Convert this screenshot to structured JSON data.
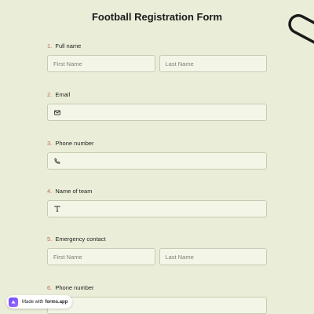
{
  "form": {
    "title": "Football Registration Form"
  },
  "questions": [
    {
      "number": "1.",
      "label": "Full name",
      "fields": [
        {
          "placeholder": "First Name"
        },
        {
          "placeholder": "Last Name"
        }
      ]
    },
    {
      "number": "2.",
      "label": "Email",
      "icon": "envelope-icon"
    },
    {
      "number": "3.",
      "label": "Phone number",
      "icon": "phone-icon"
    },
    {
      "number": "4.",
      "label": "Name of team",
      "icon": "text-icon"
    },
    {
      "number": "5.",
      "label": "Emergency contact",
      "fields": [
        {
          "placeholder": "First Name"
        },
        {
          "placeholder": "Last Name"
        }
      ]
    },
    {
      "number": "6.",
      "label": "Phone number",
      "icon": "phone-icon"
    }
  ],
  "badge": {
    "prefix": "Made with",
    "brand": "forms.app"
  },
  "colors": {
    "background": "#eaeed8",
    "input_background": "#f3f6e7",
    "number_accent": "#c5645e",
    "brand": "#6a4cff"
  }
}
